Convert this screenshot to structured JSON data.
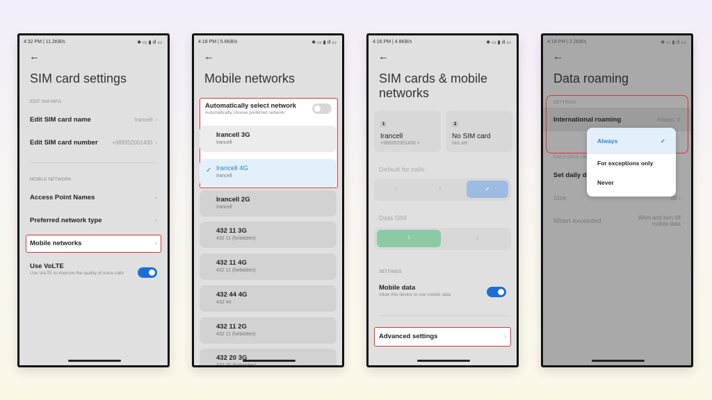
{
  "panel1": {
    "status_left": "4:32 PM | 11.2KB/s",
    "title": "SIM card settings",
    "section_edit": "EDIT SIM INFO",
    "edit_name": "Edit SIM card name",
    "edit_name_value": "Irancell",
    "edit_number": "Edit SIM card number",
    "edit_number_value": "+989352001435",
    "section_mobile": "MOBILE NETWORK",
    "apn": "Access Point Names",
    "preferred": "Preferred network type",
    "mobile_networks": "Mobile networks",
    "volte": "Use VoLTE",
    "volte_sub": "Use VoLTE to improve the quality of voice calls",
    "volte_on": true
  },
  "panel2": {
    "status_left": "4:18 PM | 5.6KB/s",
    "title": "Mobile networks",
    "auto": "Automatically select network",
    "auto_sub": "Automatically choose preferred network",
    "auto_on": false,
    "networks": [
      {
        "name": "Irancell 3G",
        "sub": "Irancell"
      },
      {
        "name": "Irancell 4G",
        "sub": "Irancell",
        "selected": true
      },
      {
        "name": "Irancell 2G",
        "sub": "Irancell"
      },
      {
        "name": "432 11 3G",
        "sub": "432 11 (forbidden)"
      },
      {
        "name": "432 11 4G",
        "sub": "432 11 (forbidden)"
      },
      {
        "name": "432 44 4G",
        "sub": "432 44"
      },
      {
        "name": "432 11 2G",
        "sub": "432 11 (forbidden)"
      },
      {
        "name": "432 20 3G",
        "sub": "432 20 (forbidden)"
      }
    ]
  },
  "panel3": {
    "status_left": "4:16 PM | 4.8KB/s",
    "title": "SIM cards & mobile networks",
    "sim1_slot": "1",
    "sim1_name": "Irancell",
    "sim1_number": "+989352001435 >",
    "sim2_slot": "2",
    "sim2_name": "No SIM card",
    "sim2_sub": "Not set",
    "calls_label": "Default for calls",
    "calls_opts": [
      "1",
      "2"
    ],
    "data_sim_label": "Data SIM",
    "data_opts": [
      "1",
      "2"
    ],
    "section_settings": "SETTINGS",
    "mobile_data": "Mobile data",
    "mobile_data_sub": "Allow this device to use mobile data",
    "mobile_data_on": true,
    "advanced": "Advanced settings"
  },
  "panel4": {
    "status_left": "4:19 PM | 2.2KB/s",
    "title": "Data roaming",
    "section_settings": "SETTINGS",
    "intl": "International roaming",
    "intl_value": "Always",
    "section_daily": "DAILY DATA LIMIT",
    "daily": "Set daily d",
    "size": "Size",
    "size_value": "0B",
    "exceeded": "When exceeded",
    "exceeded_value": "Warn and turn off mobile data",
    "options": [
      "Always",
      "For exceptions only",
      "Never"
    ],
    "selected_option": "Always"
  },
  "colors": {
    "accent": "#1a6fd6",
    "highlight": "#d9303a",
    "selected_bg": "#e3f0fb",
    "data_green": "#8ccaa5"
  }
}
